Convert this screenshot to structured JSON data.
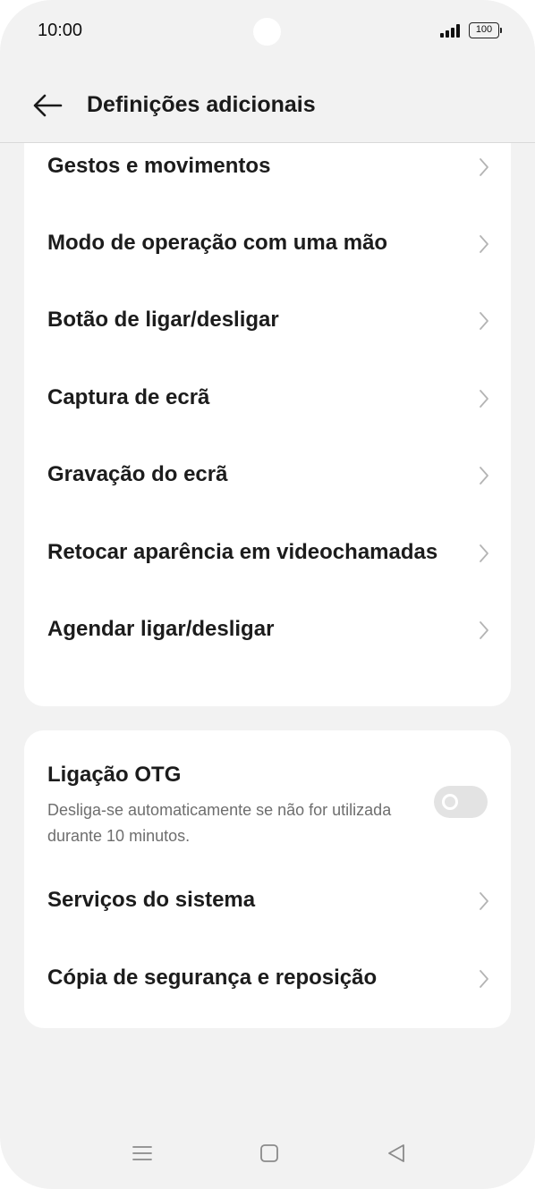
{
  "status_bar": {
    "time": "10:00",
    "battery": "100"
  },
  "header": {
    "title": "Definições adicionais"
  },
  "group1": {
    "items": [
      {
        "label": "Gestos e movimentos"
      },
      {
        "label": "Modo de operação com uma mão"
      },
      {
        "label": "Botão de ligar/desligar"
      },
      {
        "label": "Captura de ecrã"
      },
      {
        "label": "Gravação do ecrã"
      },
      {
        "label": "Retocar aparência em videochamadas"
      },
      {
        "label": "Agendar ligar/desligar"
      }
    ]
  },
  "group2": {
    "otg": {
      "title": "Ligação OTG",
      "description": "Desliga-se automaticamente se não for utilizada durante 10 minutos.",
      "enabled": false
    },
    "items": [
      {
        "label": "Serviços do sistema"
      },
      {
        "label": "Cópia de segurança e reposição"
      }
    ]
  },
  "icons": {
    "back": "back-arrow-icon",
    "chevron": "chevron-right-icon",
    "nav_menu": "menu-icon",
    "nav_home": "home-icon",
    "nav_back": "back-triangle-icon"
  },
  "colors": {
    "background": "#f2f2f2",
    "card": "#ffffff",
    "toggle_off": "#e3e3e3",
    "secondary_text": "#6e6e6e"
  }
}
